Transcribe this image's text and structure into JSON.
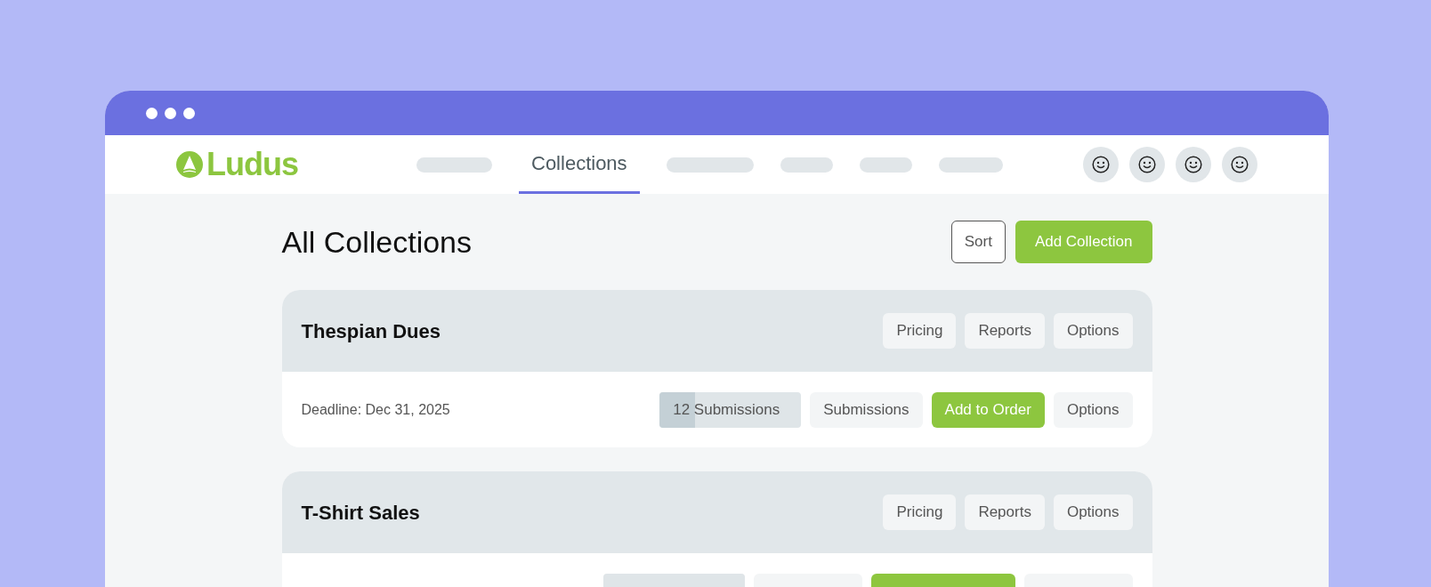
{
  "logo": "Ludus",
  "nav": [
    {
      "kind": "placeholder"
    },
    {
      "kind": "tab",
      "label": "Collections",
      "selected": true
    },
    {
      "kind": "placeholder"
    },
    {
      "kind": "placeholder"
    },
    {
      "kind": "placeholder"
    },
    {
      "kind": "placeholder"
    }
  ],
  "avatars": [
    {
      "kind": "smiley"
    },
    {
      "kind": "smiley"
    },
    {
      "kind": "smiley"
    },
    {
      "kind": "smiley"
    }
  ],
  "page_title": "All Collections",
  "actions": [
    {
      "label": "Sort",
      "kind": "outline"
    },
    {
      "label": "Add Collection",
      "kind": "primary"
    }
  ],
  "collections": [
    {
      "name": "Thespian Dues",
      "header_buttons": [
        "Pricing",
        "Reports",
        "Options"
      ],
      "deadline": "Deadline: Dec 31, 2025",
      "submissions": {
        "kind": "meter",
        "label": "12 Submissions",
        "level": 0.25
      },
      "row_buttons": [
        {
          "label": "Submissions",
          "kind": "light"
        },
        {
          "label": "Add to Order",
          "kind": "primary"
        },
        {
          "label": "Options",
          "kind": "light"
        }
      ]
    },
    {
      "name": "T-Shirt Sales",
      "header_buttons": [
        "Pricing",
        "Reports",
        "Options"
      ],
      "submissions": {
        "kind": "meter"
      },
      "row_buttons": [
        {
          "kind": "light"
        },
        {
          "kind": "primary"
        },
        {
          "kind": "light"
        }
      ]
    }
  ]
}
